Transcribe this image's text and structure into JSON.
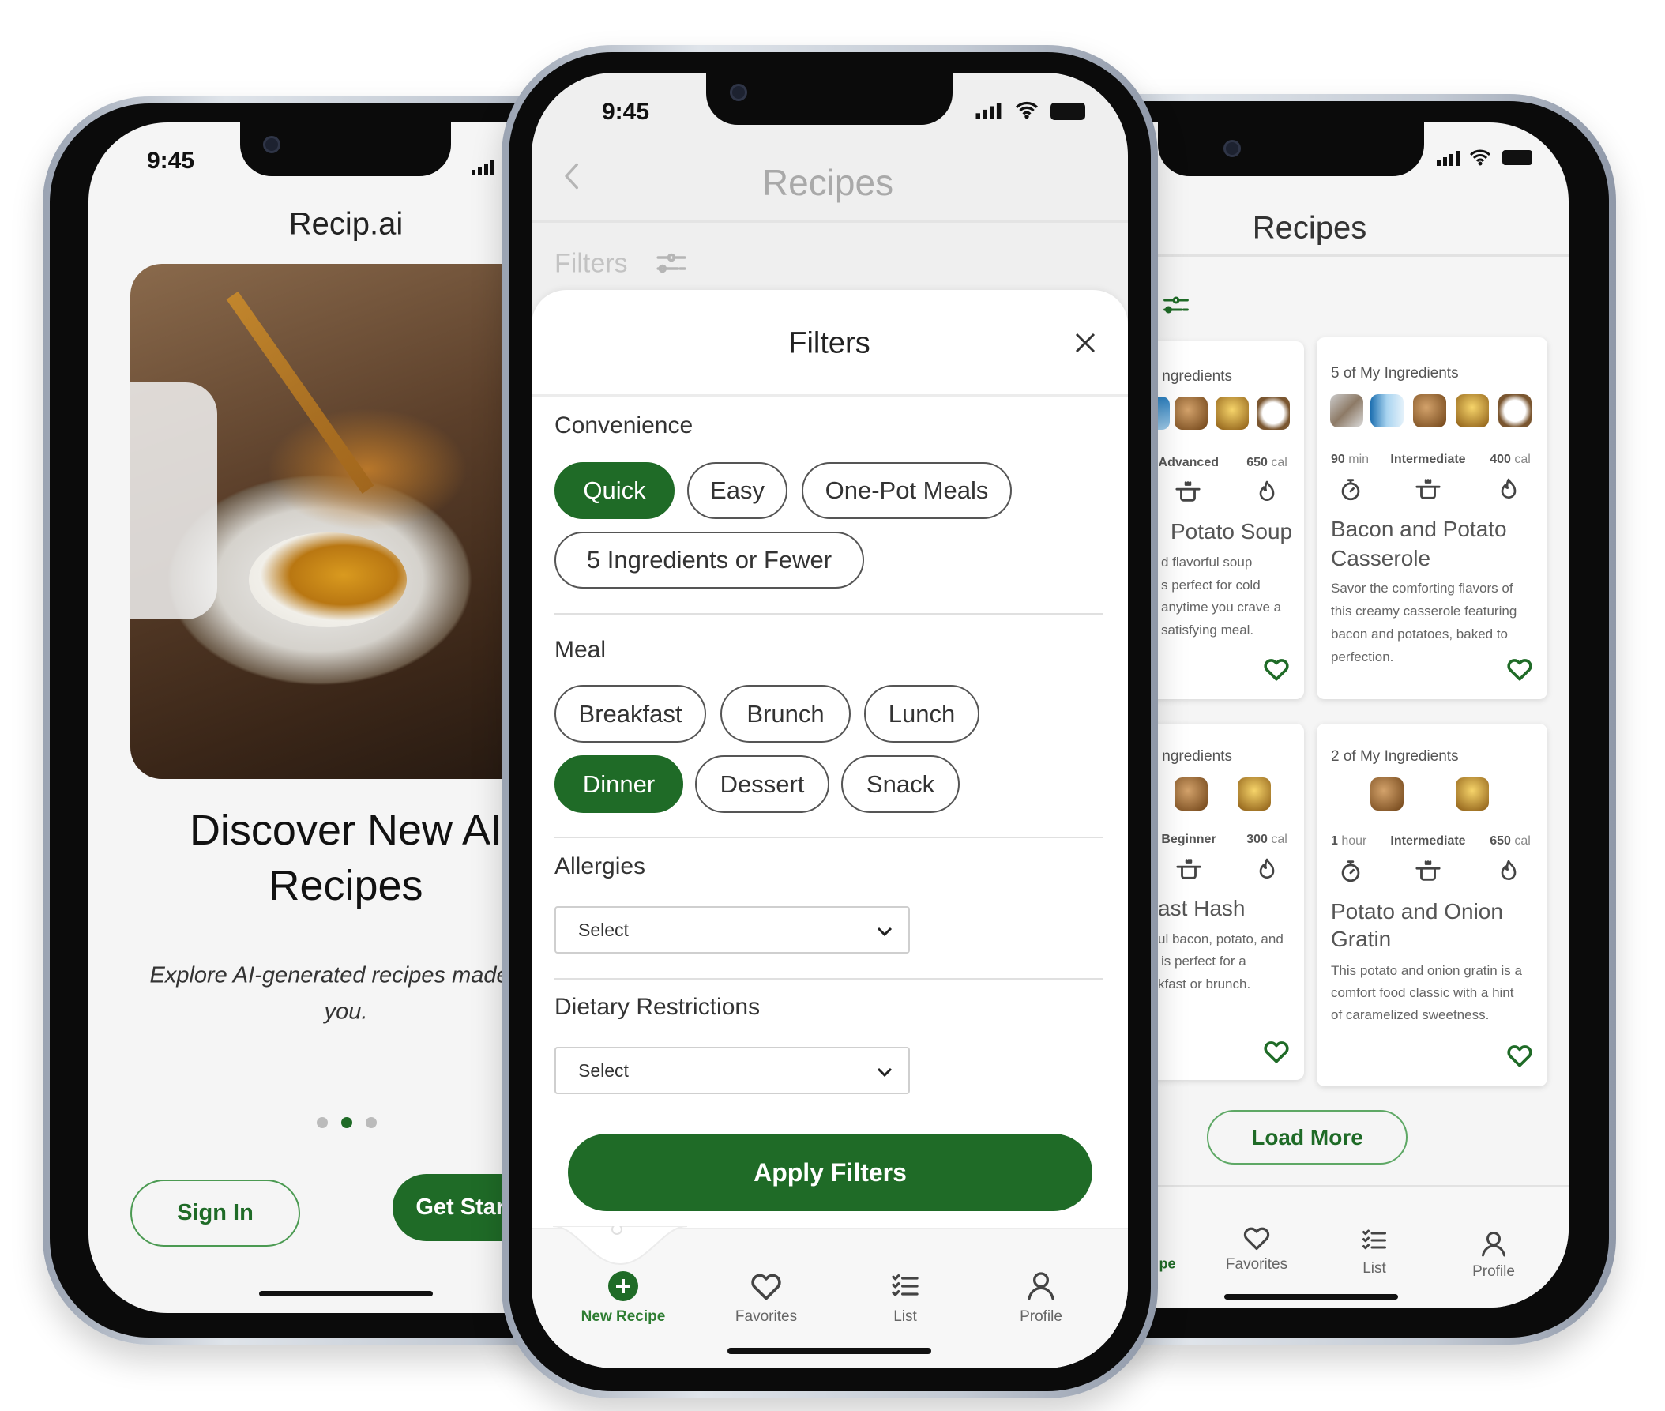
{
  "colors": {
    "accent": "#1f6b27",
    "sheet": "#ffffff",
    "overlay": "#efefef"
  },
  "left_phone": {
    "status_time": "9:45",
    "app_title": "Recip.ai",
    "headline_line1": "Discover New AI",
    "headline_line2": "Recipes",
    "subtitle_line1": "Explore AI-generated recipes made for",
    "subtitle_line2": "you.",
    "carousel": {
      "count": 3,
      "active_index": 1
    },
    "sign_in_label": "Sign In",
    "get_started_label": "Get Started"
  },
  "center_phone": {
    "status_time": "9:45",
    "header_title": "Recipes",
    "filters_bar_label": "Filters",
    "sheet": {
      "title": "Filters",
      "sections": [
        {
          "title": "Convenience",
          "chips": [
            {
              "label": "Quick",
              "selected": true
            },
            {
              "label": "Easy",
              "selected": false
            },
            {
              "label": "One-Pot Meals",
              "selected": false
            },
            {
              "label": "5 Ingredients or Fewer",
              "selected": false
            }
          ]
        },
        {
          "title": "Meal",
          "chips": [
            {
              "label": "Breakfast",
              "selected": false
            },
            {
              "label": "Brunch",
              "selected": false
            },
            {
              "label": "Lunch",
              "selected": false
            },
            {
              "label": "Dinner",
              "selected": true
            },
            {
              "label": "Dessert",
              "selected": false
            },
            {
              "label": "Snack",
              "selected": false
            }
          ]
        },
        {
          "title": "Allergies",
          "select_value": "Select"
        },
        {
          "title": "Dietary Restrictions",
          "select_value": "Select"
        }
      ],
      "apply_label": "Apply Filters"
    },
    "nav": [
      {
        "label": "New Recipe",
        "icon": "plus-circle-icon",
        "active": true
      },
      {
        "label": "Favorites",
        "icon": "heart-icon"
      },
      {
        "label": "List",
        "icon": "checklist-icon"
      },
      {
        "label": "Profile",
        "icon": "user-icon"
      }
    ]
  },
  "right_phone": {
    "header_title": "Recipes",
    "cards": [
      {
        "ingredients_label": "ngredients",
        "difficulty": "Advanced",
        "calories": "650",
        "cal_unit": "cal",
        "title": "Potato Soup",
        "desc": [
          "d flavorful soup",
          "s perfect for cold",
          "anytime you crave a",
          "satisfying meal."
        ]
      },
      {
        "ingredients_label": "5 of My Ingredients",
        "time": "90",
        "time_unit": "min",
        "difficulty": "Intermediate",
        "calories": "400",
        "cal_unit": "cal",
        "title_line1": "Bacon and Potato",
        "title_line2": "Casserole",
        "desc": [
          "Savor the comforting flavors of",
          "this creamy casserole featuring",
          "bacon and potatoes, baked to",
          "perfection."
        ]
      },
      {
        "ingredients_label": "ngredients",
        "difficulty": "Beginner",
        "calories": "300",
        "cal_unit": "cal",
        "title": "ast Hash",
        "desc": [
          "ul bacon, potato, and",
          "is perfect for a",
          "kfast or brunch."
        ]
      },
      {
        "ingredients_label": "2 of My Ingredients",
        "time": "1",
        "time_unit": "hour",
        "difficulty": "Intermediate",
        "calories": "650",
        "cal_unit": "cal",
        "title_line1": "Potato and Onion",
        "title_line2": "Gratin",
        "desc": [
          "This potato and onion gratin is a",
          "comfort food classic with a hint",
          "of caramelized sweetness."
        ]
      }
    ],
    "load_more_label": "Load More",
    "nav": [
      {
        "label": "pe",
        "active": true
      },
      {
        "label": "Favorites",
        "icon": "heart-icon"
      },
      {
        "label": "List",
        "icon": "checklist-icon"
      },
      {
        "label": "Profile",
        "icon": "user-icon"
      }
    ]
  }
}
